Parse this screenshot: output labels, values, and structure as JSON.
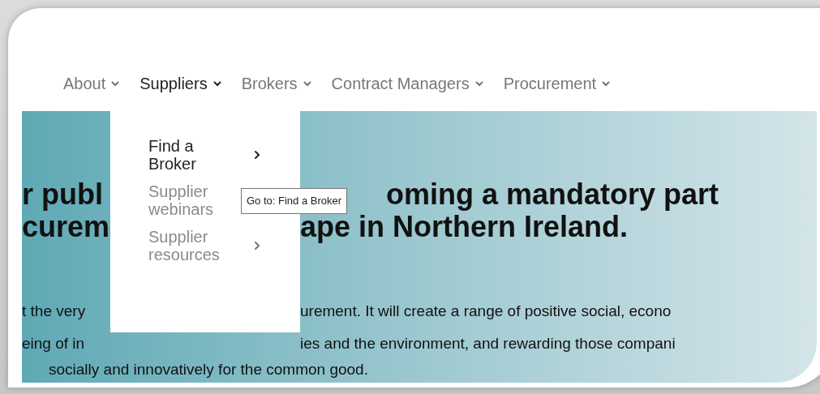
{
  "nav": [
    {
      "label": "About",
      "selected": false
    },
    {
      "label": "Suppliers",
      "selected": true
    },
    {
      "label": "Brokers",
      "selected": false
    },
    {
      "label": "Contract Managers",
      "selected": false
    },
    {
      "label": "Procurement",
      "selected": false
    }
  ],
  "dropdown": {
    "items": [
      {
        "label": "Find a Broker",
        "highlighted": true
      },
      {
        "label": "Supplier webinars",
        "highlighted": false
      },
      {
        "label": "Supplier resources",
        "highlighted": false
      }
    ]
  },
  "tooltip": "Go to: Find a Broker",
  "hero": {
    "heading_lines": [
      {
        "left": "r publ",
        "right": "oming a mandatory part"
      },
      {
        "left": "curem",
        "right": "ape in Northern Ireland."
      }
    ],
    "paragraph_top": {
      "left": "t the very",
      "right": "urement. It will create a range of positive social, econo"
    },
    "paragraph_middle": {
      "left": "eing of in",
      "right": "ies and the environment, and rewarding those compani"
    },
    "paragraph_last": "socially and innovatively for the common good."
  }
}
